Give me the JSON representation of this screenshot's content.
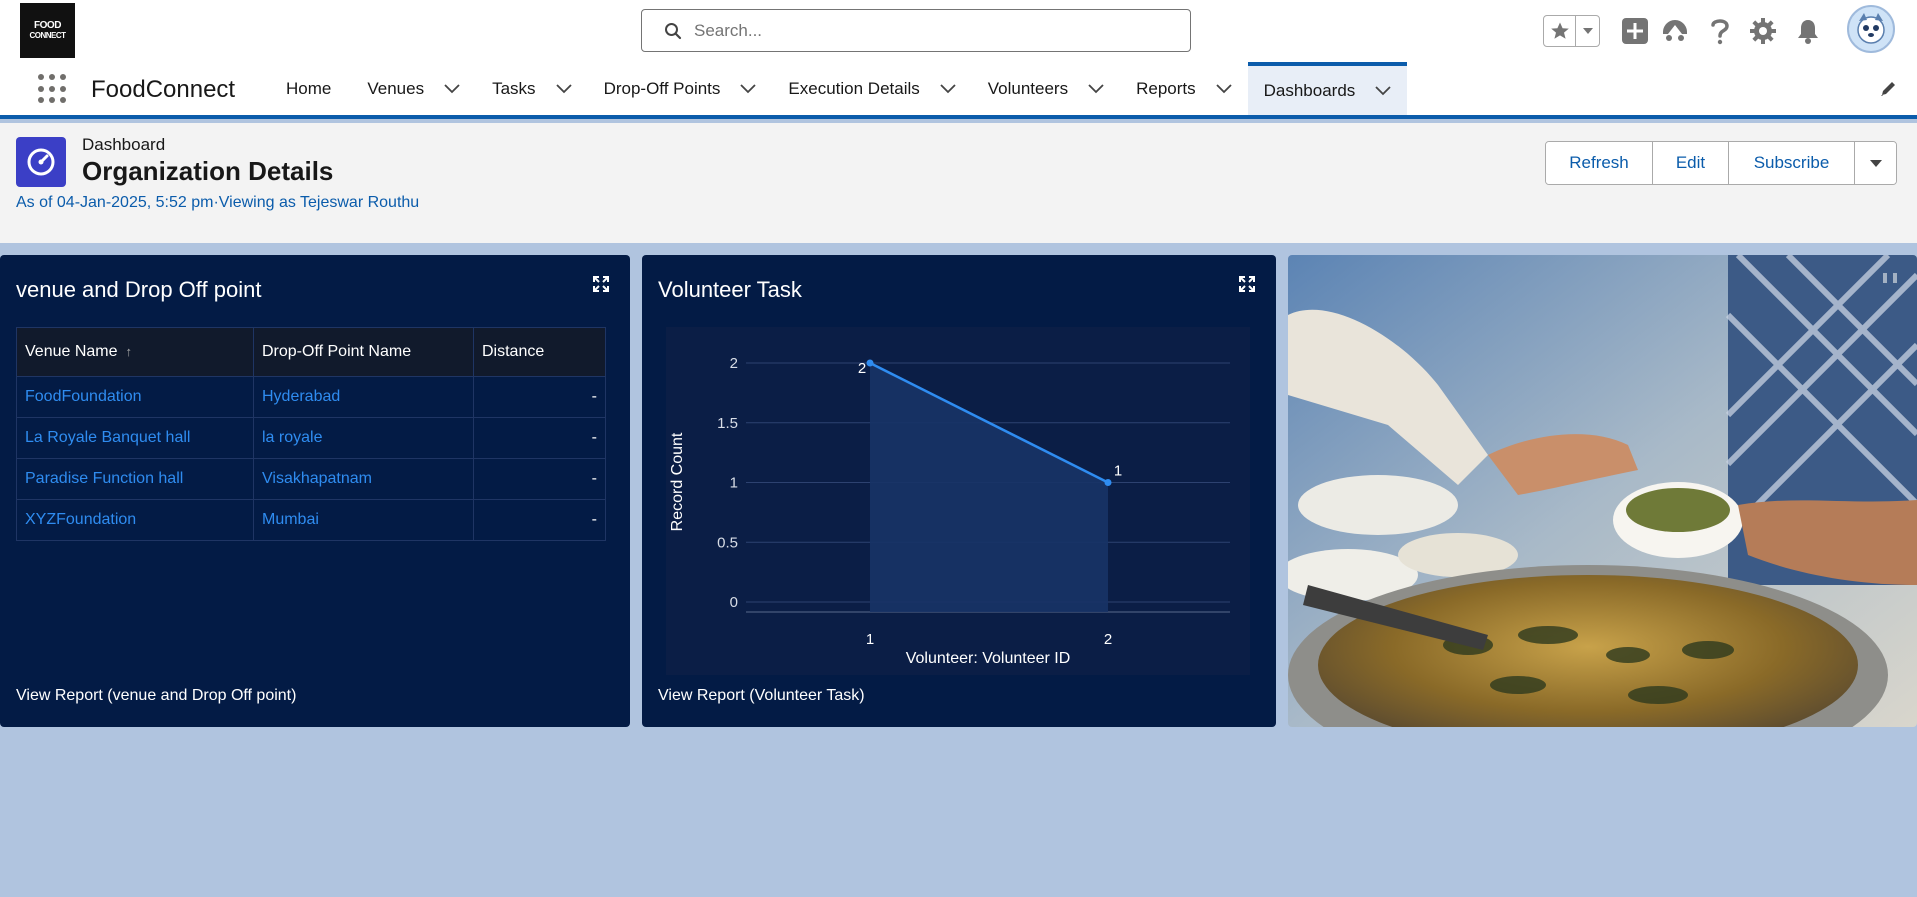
{
  "brand": {
    "logo_line1": "FOOD",
    "logo_line2": "CONNECT"
  },
  "search": {
    "placeholder": "Search..."
  },
  "header_icons": [
    "star-icon",
    "chevron-down-icon",
    "add-icon",
    "trailhead-icon",
    "help-icon",
    "setup-gear-icon",
    "bell-icon",
    "avatar"
  ],
  "app": {
    "name": "FoodConnect"
  },
  "nav": {
    "items": [
      {
        "label": "Home",
        "dropdown": false
      },
      {
        "label": "Venues",
        "dropdown": true
      },
      {
        "label": "Tasks",
        "dropdown": true
      },
      {
        "label": "Drop-Off Points",
        "dropdown": true
      },
      {
        "label": "Execution Details",
        "dropdown": true
      },
      {
        "label": "Volunteers",
        "dropdown": true
      },
      {
        "label": "Reports",
        "dropdown": true
      },
      {
        "label": "Dashboards",
        "dropdown": true,
        "active": true
      }
    ]
  },
  "dashboard": {
    "kicker": "Dashboard",
    "title": "Organization Details",
    "subtitle": "As of 04-Jan-2025, 5:52 pm·Viewing as Tejeswar Routhu",
    "buttons": {
      "refresh": "Refresh",
      "edit": "Edit",
      "subscribe": "Subscribe"
    }
  },
  "venue_panel": {
    "title": "venue and Drop Off point",
    "columns": [
      "Venue Name",
      "Drop-Off Point Name",
      "Distance"
    ],
    "rows": [
      [
        "FoodFoundation",
        "Hyderabad",
        "-"
      ],
      [
        "La Royale Banquet hall",
        "la royale",
        "-"
      ],
      [
        "Paradise Function hall",
        "Visakhapatnam",
        "-"
      ],
      [
        "XYZFoundation",
        "Mumbai",
        "-"
      ]
    ],
    "view_report": "View Report (venue and Drop Off point)"
  },
  "volunteer_panel": {
    "title": "Volunteer Task",
    "view_report": "View Report (Volunteer Task)"
  },
  "chart_data": {
    "type": "area",
    "xlabel": "Volunteer: Volunteer ID",
    "ylabel": "Record Count",
    "categories": [
      "1",
      "2"
    ],
    "values": [
      2,
      1
    ],
    "data_labels": [
      "2",
      "1"
    ],
    "yticks": [
      "2",
      "1.5",
      "1",
      "0.5",
      "0"
    ],
    "ylim": [
      0,
      2
    ],
    "grid": true,
    "line_color": "#2f8cf0"
  },
  "colors": {
    "accent": "#0b5cab",
    "panel_bg": "#031b45",
    "page_bg": "#b0c4df",
    "link": "#2f8cf0"
  }
}
